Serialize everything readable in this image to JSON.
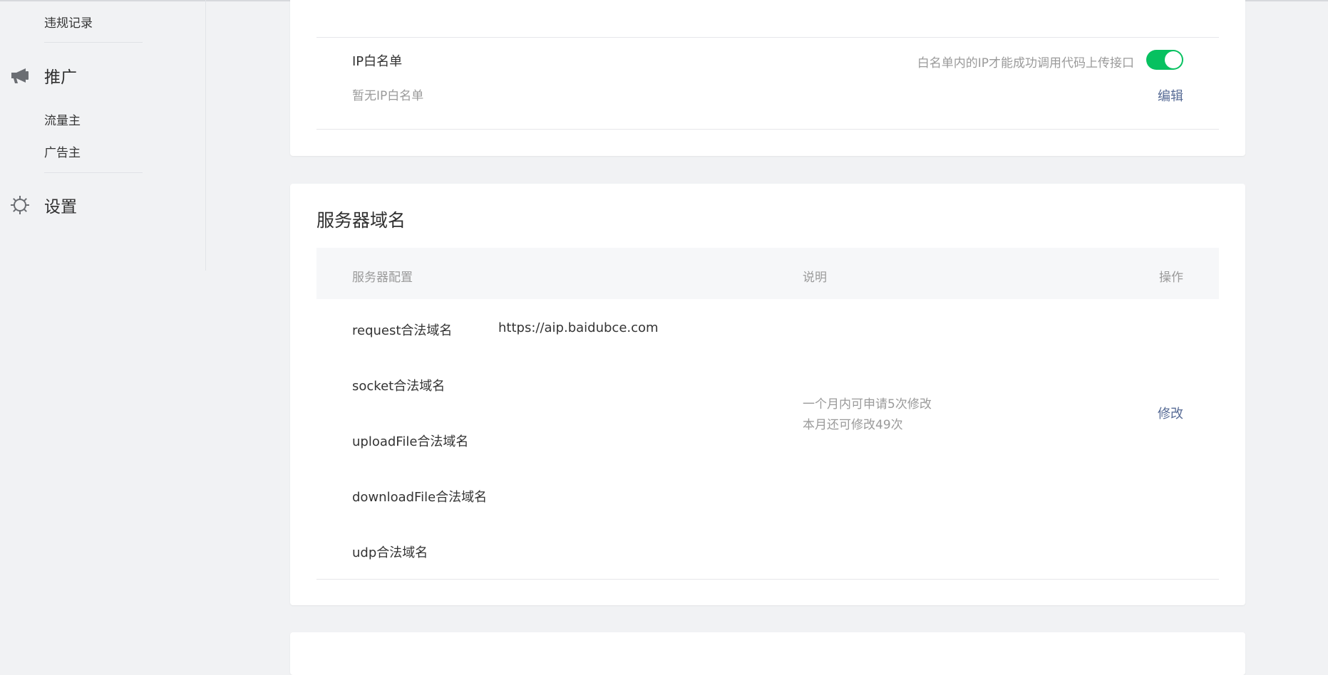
{
  "sidebar": {
    "violation_record": "违规记录",
    "promotion": {
      "label": "推广",
      "items": [
        "流量主",
        "广告主"
      ]
    },
    "settings": {
      "label": "设置"
    }
  },
  "ip_card": {
    "cropped_text": "··· ·· · ··· ·",
    "title": "IP白名单",
    "empty_text": "暂无IP白名单",
    "hint": "白名单内的IP才能成功调用代码上传接口",
    "toggle_on": true,
    "edit_label": "编辑"
  },
  "domain_card": {
    "title": "服务器域名",
    "columns": {
      "config": "服务器配置",
      "description": "说明",
      "action": "操作"
    },
    "rows": [
      {
        "name": "request合法域名",
        "value": "https://aip.baidubce.com"
      },
      {
        "name": "socket合法域名",
        "value": ""
      },
      {
        "name": "uploadFile合法域名",
        "value": ""
      },
      {
        "name": "downloadFile合法域名",
        "value": ""
      },
      {
        "name": "udp合法域名",
        "value": ""
      }
    ],
    "description": {
      "line1": "一个月内可申请5次修改",
      "line2": "本月还可修改49次"
    },
    "modify_label": "修改"
  },
  "colors": {
    "accent_green": "#07c160",
    "link": "#576b95",
    "muted_text": "#9a9a9a"
  }
}
